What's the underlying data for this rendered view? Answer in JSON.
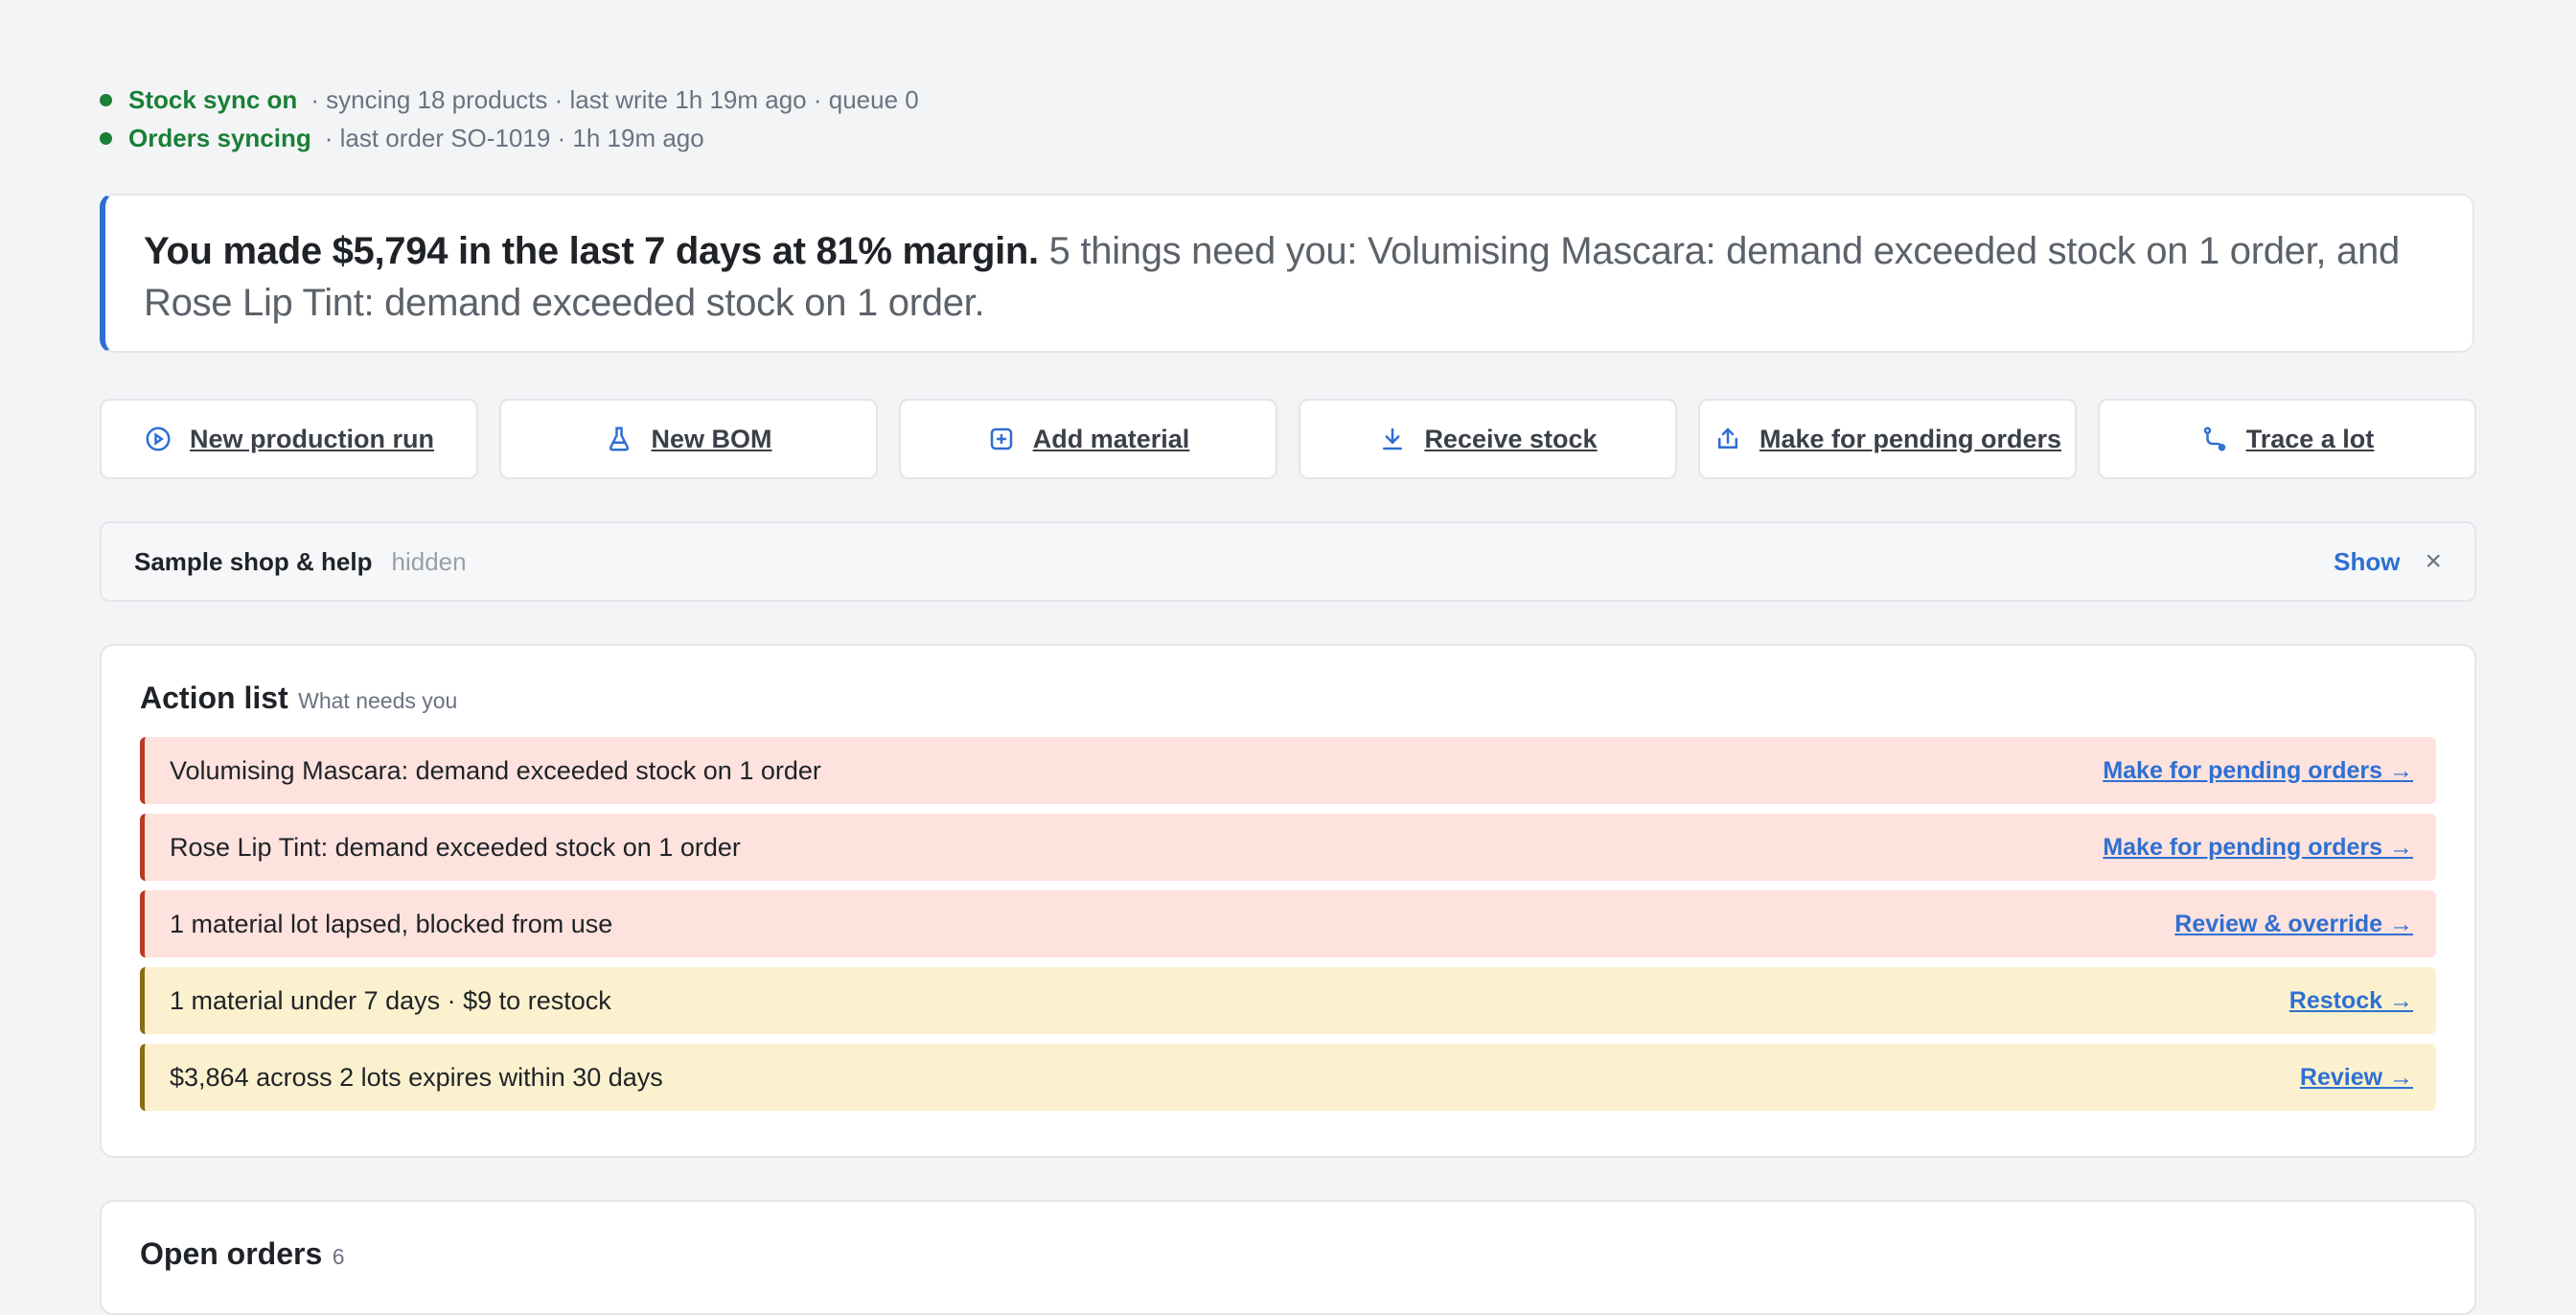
{
  "status": {
    "stock_sync": {
      "label": "Stock sync on",
      "meta": "· syncing 18 products · last write 1h 19m ago · queue 0"
    },
    "orders_sync": {
      "label": "Orders syncing",
      "meta": "· last order SO-1019 · 1h 19m ago"
    }
  },
  "summary": {
    "strong": "You made $5,794 in the last 7 days at 81% margin.",
    "rest": "5 things need you: Volumising Mascara: demand exceeded stock on 1 order, and Rose Lip Tint: demand exceeded stock on 1 order."
  },
  "quick_actions": [
    {
      "label": "New production run",
      "icon": "play-circle-icon"
    },
    {
      "label": "New BOM",
      "icon": "flask-icon"
    },
    {
      "label": "Add material",
      "icon": "plus-square-icon"
    },
    {
      "label": "Receive stock",
      "icon": "download-icon"
    },
    {
      "label": "Make for pending orders",
      "icon": "share-up-icon"
    },
    {
      "label": "Trace a lot",
      "icon": "route-icon"
    }
  ],
  "help_bar": {
    "title": "Sample shop & help",
    "state": "hidden",
    "show_label": "Show",
    "close_glyph": "×"
  },
  "action_list": {
    "title": "Action list",
    "subtitle": "What needs you",
    "items": [
      {
        "text": "Volumising Mascara: demand exceeded stock on 1 order",
        "link": "Make for pending orders →",
        "severity": "red"
      },
      {
        "text": "Rose Lip Tint: demand exceeded stock on 1 order",
        "link": "Make for pending orders →",
        "severity": "red"
      },
      {
        "text": "1 material lot lapsed, blocked from use",
        "link": "Review & override →",
        "severity": "red"
      },
      {
        "text": "1 material under 7 days · $9 to restock",
        "link": "Restock →",
        "severity": "yellow"
      },
      {
        "text": "$3,864 across 2 lots expires within 30 days",
        "link": "Review →",
        "severity": "yellow"
      }
    ]
  },
  "open_orders": {
    "title": "Open orders",
    "count": "6"
  },
  "colors": {
    "accent": "#2f6fd1",
    "success": "#1a7f37",
    "danger": "#b83a22",
    "warning": "#8a6d12"
  }
}
